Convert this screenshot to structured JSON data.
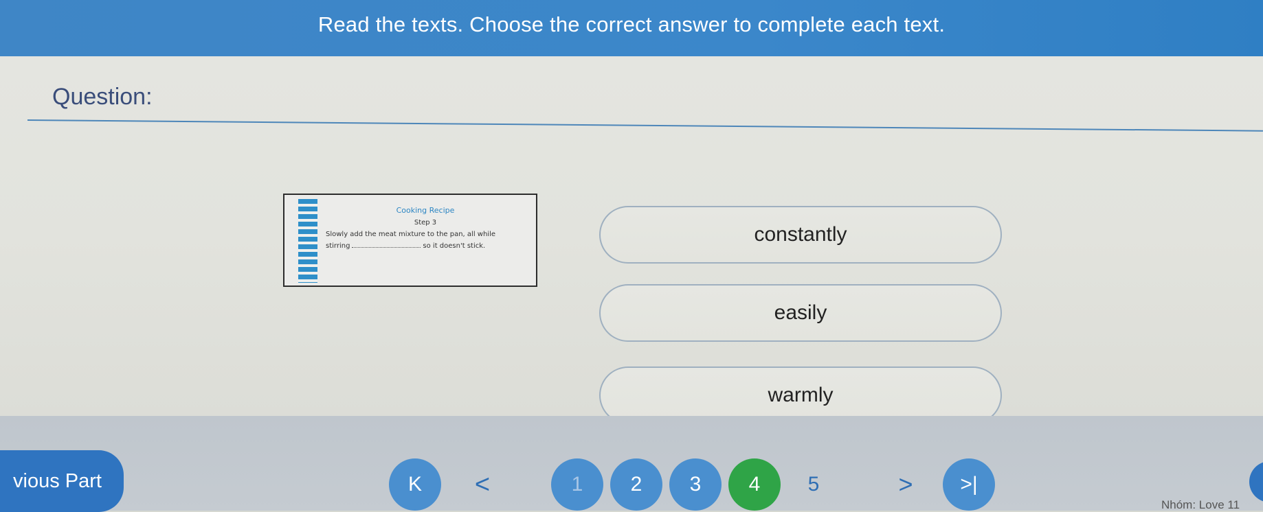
{
  "header": {
    "instruction": "Read the texts. Choose the correct answer to complete each text."
  },
  "question": {
    "label": "Question:"
  },
  "recipe": {
    "title": "Cooking Recipe",
    "step": "Step 3",
    "line1": "Slowly add the meat mixture to the pan, all while",
    "line2_before": "stirring",
    "line2_after": "so it doesn't stick."
  },
  "options": [
    "constantly",
    "easily",
    "warmly"
  ],
  "navigation": {
    "previous_part": "vious Part",
    "first_icon": "K",
    "prev_icon": "<",
    "pages": [
      "1",
      "2",
      "3",
      "4",
      "5"
    ],
    "current_page": "4",
    "next_icon": ">",
    "last_icon": ">|"
  },
  "footer": {
    "note": "Nhóm: Love 11"
  },
  "colors": {
    "accent": "#3b87ca",
    "current_page": "#2fa447"
  }
}
